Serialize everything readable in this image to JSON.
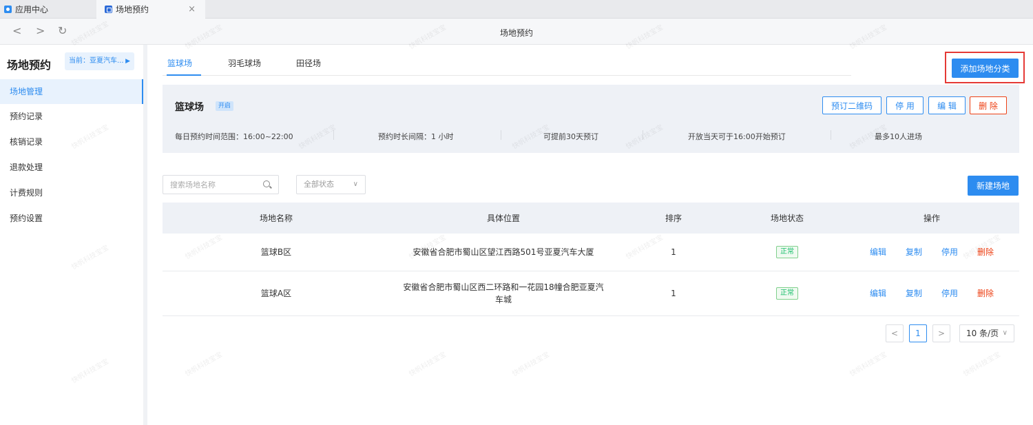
{
  "tabs": [
    {
      "label": "应用中心"
    },
    {
      "label": "场地预约"
    }
  ],
  "window": {
    "title": "场地预约"
  },
  "sidebar": {
    "title": "场地预约",
    "current": "当前：亚夏汽车...",
    "items": [
      {
        "label": "场地管理",
        "active": true
      },
      {
        "label": "预约记录"
      },
      {
        "label": "核销记录"
      },
      {
        "label": "退款处理"
      },
      {
        "label": "计费规则"
      },
      {
        "label": "预约设置"
      }
    ]
  },
  "categories": [
    {
      "label": "篮球场",
      "active": true
    },
    {
      "label": "羽毛球场"
    },
    {
      "label": "田径场"
    }
  ],
  "add_category_label": "添加场地分类",
  "venue_info": {
    "name": "篮球场",
    "badge": "开启",
    "buttons": {
      "qrcode": "预订二维码",
      "disable": "停 用",
      "edit": "编 辑",
      "delete": "删 除"
    },
    "fields": [
      "每日预约时间范围：16:00~22:00",
      "预约时长间隔：1 小时",
      "可提前30天预订",
      "开放当天可于16:00开始预订",
      "最多10人进场"
    ]
  },
  "filters": {
    "search_placeholder": "搜索场地名称",
    "status": "全部状态",
    "new_venue_label": "新建场地"
  },
  "table": {
    "headers": [
      "场地名称",
      "具体位置",
      "排序",
      "场地状态",
      "操作"
    ],
    "rows": [
      {
        "name": "篮球B区",
        "location": "安徽省合肥市蜀山区望江西路501号亚夏汽车大厦",
        "order": "1",
        "status": "正常"
      },
      {
        "name": "篮球A区",
        "location": "安徽省合肥市蜀山区西二环路和一花园18幢合肥亚夏汽车城",
        "order": "1",
        "status": "正常"
      }
    ],
    "actions": {
      "edit": "编辑",
      "copy": "复制",
      "disable": "停用",
      "delete": "删除"
    }
  },
  "pagination": {
    "prev": "<",
    "current": "1",
    "next": ">",
    "page_size": "10 条/页"
  },
  "watermark": "快帆科技宝宝",
  "colors": {
    "primary": "#2d8cf0",
    "danger": "#ed4014",
    "success": "#19be6b",
    "highlight_box": "#e53935"
  }
}
